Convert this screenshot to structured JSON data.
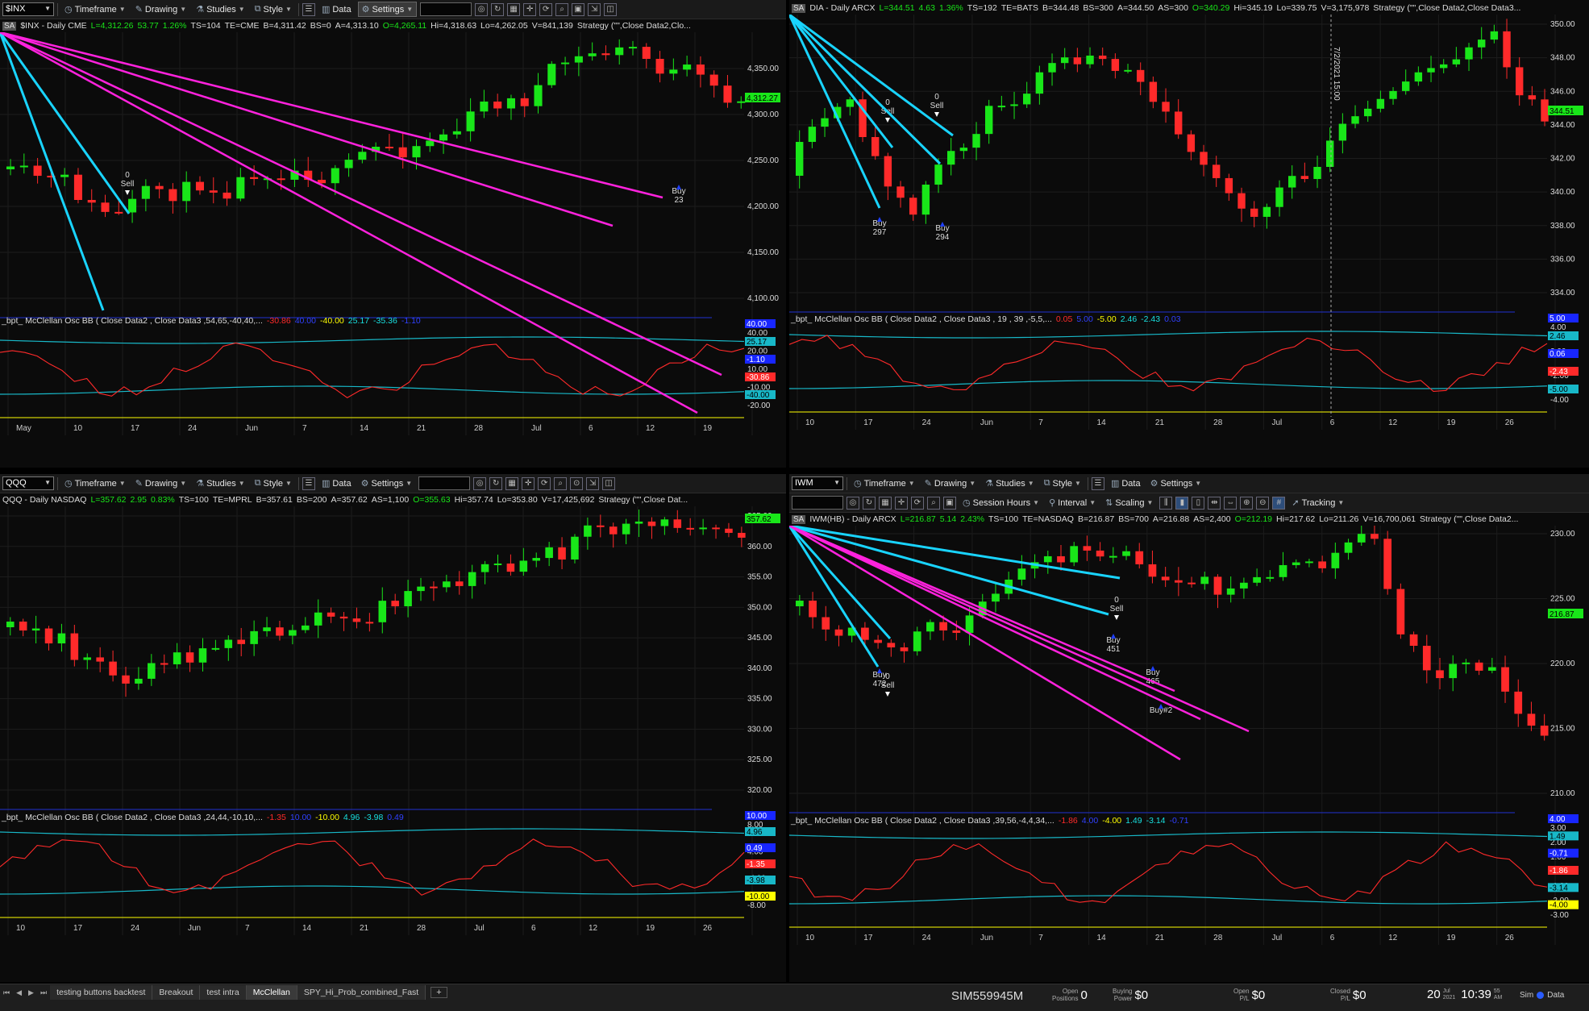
{
  "panes": {
    "tl": {
      "symbol": "$INX",
      "toolbar": [
        "Timeframe",
        "Drawing",
        "Studies",
        "Style",
        "Data",
        "Settings"
      ],
      "info": {
        "name": "$INX - Daily  CME",
        "last": "L=4,312.26",
        "chg": "53.77",
        "pct": "1.26%",
        "ts": "TS=104",
        "te": "TE=CME",
        "bid": "B=4,311.42",
        "bs": "BS=0",
        "ask": "A=4,313.10",
        "open": "O=4,265.11",
        "hi": "Hi=4,318.63",
        "lo": "Lo=4,262.05",
        "vol": "V=841,139",
        "strategy": "Strategy (\"\",Close Data2,Clo..."
      },
      "price_ticks": [
        "4,350.00",
        "4,300.00",
        "4,250.00",
        "4,200.00",
        "4,150.00",
        "4,100.00"
      ],
      "price_badge": "4,312.27",
      "indicator": {
        "label": "_bpt_ McClellan Osc BB ( Close Data2 , Close Data3 ,54,65,-40,40,...",
        "v1": "-30.86",
        "v2": "40.00",
        "v3": "-40.00",
        "v4": "25.17",
        "v5": "-35.36",
        "v6": "-1.10"
      },
      "ind_ticks": [
        "40.00",
        "20.00",
        "10.00",
        "-10.00",
        "-20.00"
      ],
      "ind_badges": [
        "40.00",
        "25.17",
        "-1.10",
        "-30.86",
        "-40.00"
      ],
      "x_labels": [
        "May",
        "10",
        "17",
        "24",
        "Jun",
        "7",
        "14",
        "21",
        "28",
        "Jul",
        "6",
        "12",
        "19"
      ],
      "signals": [
        {
          "top": "0",
          "mid": "Sell"
        },
        {
          "top": "Buy",
          "mid": "23"
        }
      ]
    },
    "tr": {
      "symbol": "DIA",
      "info": {
        "name": "DIA - Daily  ARCX",
        "last": "L=344.51",
        "chg": "4.63",
        "pct": "1.36%",
        "ts": "TS=192",
        "te": "TE=BATS",
        "bid": "B=344.48",
        "bs": "BS=300",
        "ask": "A=344.50",
        "as": "AS=300",
        "open": "O=340.29",
        "hi": "Hi=345.19",
        "lo": "Lo=339.75",
        "vol": "V=3,175,978",
        "strategy": "Strategy (\"\",Close Data2,Close Data3..."
      },
      "price_ticks": [
        "350.00",
        "348.00",
        "346.00",
        "344.00",
        "342.00",
        "340.00",
        "338.00",
        "336.00",
        "334.00"
      ],
      "price_badge": "344.51",
      "crosshair": "7/2/2021 15:00",
      "indicator": {
        "label": "_bpt_ McClellan Osc BB ( Close Data2 , Close Data3 , 19 , 39 ,-5,5,...",
        "v1": "0.05",
        "v2": "5.00",
        "v3": "-5.00",
        "v4": "2.46",
        "v5": "-2.43",
        "v6": "0.03"
      },
      "ind_ticks": [
        "4.00",
        "2.00",
        "-2.00",
        "-4.00"
      ],
      "ind_badges": [
        "5.00",
        "2.46",
        "0.06",
        "-2.43",
        "-5.00"
      ],
      "x_labels": [
        "10",
        "17",
        "24",
        "Jun",
        "7",
        "14",
        "21",
        "28",
        "Jul",
        "6",
        "12",
        "19",
        "26"
      ],
      "signals": [
        {
          "top": "0",
          "mid": "Sell"
        },
        {
          "top": "0",
          "mid": "Sell"
        },
        {
          "top": "Buy",
          "mid": "297"
        },
        {
          "top": "Buy",
          "mid": "294"
        }
      ]
    },
    "bl": {
      "symbol": "QQQ",
      "info": {
        "name": "QQQ - Daily  NASDAQ",
        "last": "L=357.62",
        "chg": "2.95",
        "pct": "0.83%",
        "ts": "TS=100",
        "te": "TE=MPRL",
        "bid": "B=357.61",
        "bs": "BS=200",
        "ask": "A=357.62",
        "as": "AS=1,100",
        "open": "O=355.63",
        "hi": "Hi=357.74",
        "lo": "Lo=353.80",
        "vol": "V=17,425,692",
        "strategy": "Strategy (\"\",Close Dat..."
      },
      "price_ticks": [
        "365.00",
        "360.00",
        "355.00",
        "350.00",
        "345.00",
        "340.00",
        "335.00",
        "330.00",
        "325.00",
        "320.00"
      ],
      "price_badge": "357.62",
      "indicator": {
        "label": "_bpt_ McClellan Osc BB ( Close Data2 , Close Data3 ,24,44,-10,10,...",
        "v1": "-1.35",
        "v2": "10.00",
        "v3": "-10.00",
        "v4": "4.96",
        "v5": "-3.98",
        "v6": "0.49"
      },
      "ind_ticks": [
        "8.00",
        "4.00",
        "-4.00",
        "-8.00"
      ],
      "ind_badges": [
        "10.00",
        "4.96",
        "0.49",
        "-1.35",
        "-3.98",
        "-10.00"
      ],
      "x_labels": [
        "10",
        "17",
        "24",
        "Jun",
        "7",
        "14",
        "21",
        "28",
        "Jul",
        "6",
        "12",
        "19",
        "26"
      ]
    },
    "br": {
      "symbol": "IWM",
      "toolbar2": [
        "Session Hours",
        "Interval",
        "Scaling",
        "Tracking"
      ],
      "info": {
        "name": "IWM(HB) - Daily  ARCX",
        "last": "L=216.87",
        "chg": "5.14",
        "pct": "2.43%",
        "ts": "TS=100",
        "te": "TE=NASDAQ",
        "bid": "B=216.87",
        "bs": "BS=700",
        "ask": "A=216.88",
        "as": "AS=2,400",
        "open": "O=212.19",
        "hi": "Hi=217.62",
        "lo": "Lo=211.26",
        "vol": "V=16,700,061",
        "strategy": "Strategy (\"\",Close Data2..."
      },
      "price_ticks": [
        "230.00",
        "225.00",
        "220.00",
        "215.00",
        "210.00"
      ],
      "price_badge": "216.87",
      "indicator": {
        "label": "_bpt_ McClellan Osc BB ( Close Data2 , Close Data3 ,39,56,-4,4,34,...",
        "v1": "-1.86",
        "v2": "4.00",
        "v3": "-4.00",
        "v4": "1.49",
        "v5": "-3.14",
        "v6": "-0.71"
      },
      "ind_ticks": [
        "3.00",
        "2.00",
        "1.00",
        "0.00",
        "-1.00",
        "-2.00",
        "-3.00"
      ],
      "ind_badges": [
        "4.00",
        "1.49",
        "-0.71",
        "-1.86",
        "-3.14",
        "-4.00"
      ],
      "x_labels": [
        "10",
        "17",
        "24",
        "Jun",
        "7",
        "14",
        "21",
        "28",
        "Jul",
        "6",
        "12",
        "19",
        "26"
      ],
      "signals": [
        {
          "top": "0",
          "mid": "Sell"
        },
        {
          "top": "0",
          "mid": "Sell"
        },
        {
          "top": "Buy",
          "mid": "472"
        },
        {
          "top": "Buy",
          "mid": "451"
        },
        {
          "top": "Buy",
          "mid": "465"
        },
        {
          "top": "Buy#2",
          "mid": ""
        }
      ]
    }
  },
  "tabs": [
    "testing buttons backtest",
    "Breakout",
    "test intra",
    "McClellan",
    "SPY_Hi_Prob_combined_Fast"
  ],
  "active_tab": "McClellan",
  "account": "SIM559945M",
  "stats": [
    {
      "label1": "Open",
      "label2": "Positions",
      "value": "0"
    },
    {
      "label1": "Buying",
      "label2": "Power",
      "value": "$0"
    },
    {
      "label1": "Open",
      "label2": "P/L",
      "value": "$0"
    },
    {
      "label1": "Closed",
      "label2": "P/L",
      "value": "$0"
    }
  ],
  "clock": {
    "day": "20",
    "month": "Jul",
    "year": "2021",
    "time": "10:39",
    "sec": "55",
    "ampm": "AM"
  },
  "status": {
    "sim": "Sim",
    "data": "Data"
  },
  "colors": {
    "up": "#19e619",
    "down": "#ff2a2a",
    "band": "#18b8c8",
    "osc": "#ff2a2a",
    "zero": "#ffff00",
    "magenta": "#ff22dd",
    "price_badge": "#19e619"
  }
}
